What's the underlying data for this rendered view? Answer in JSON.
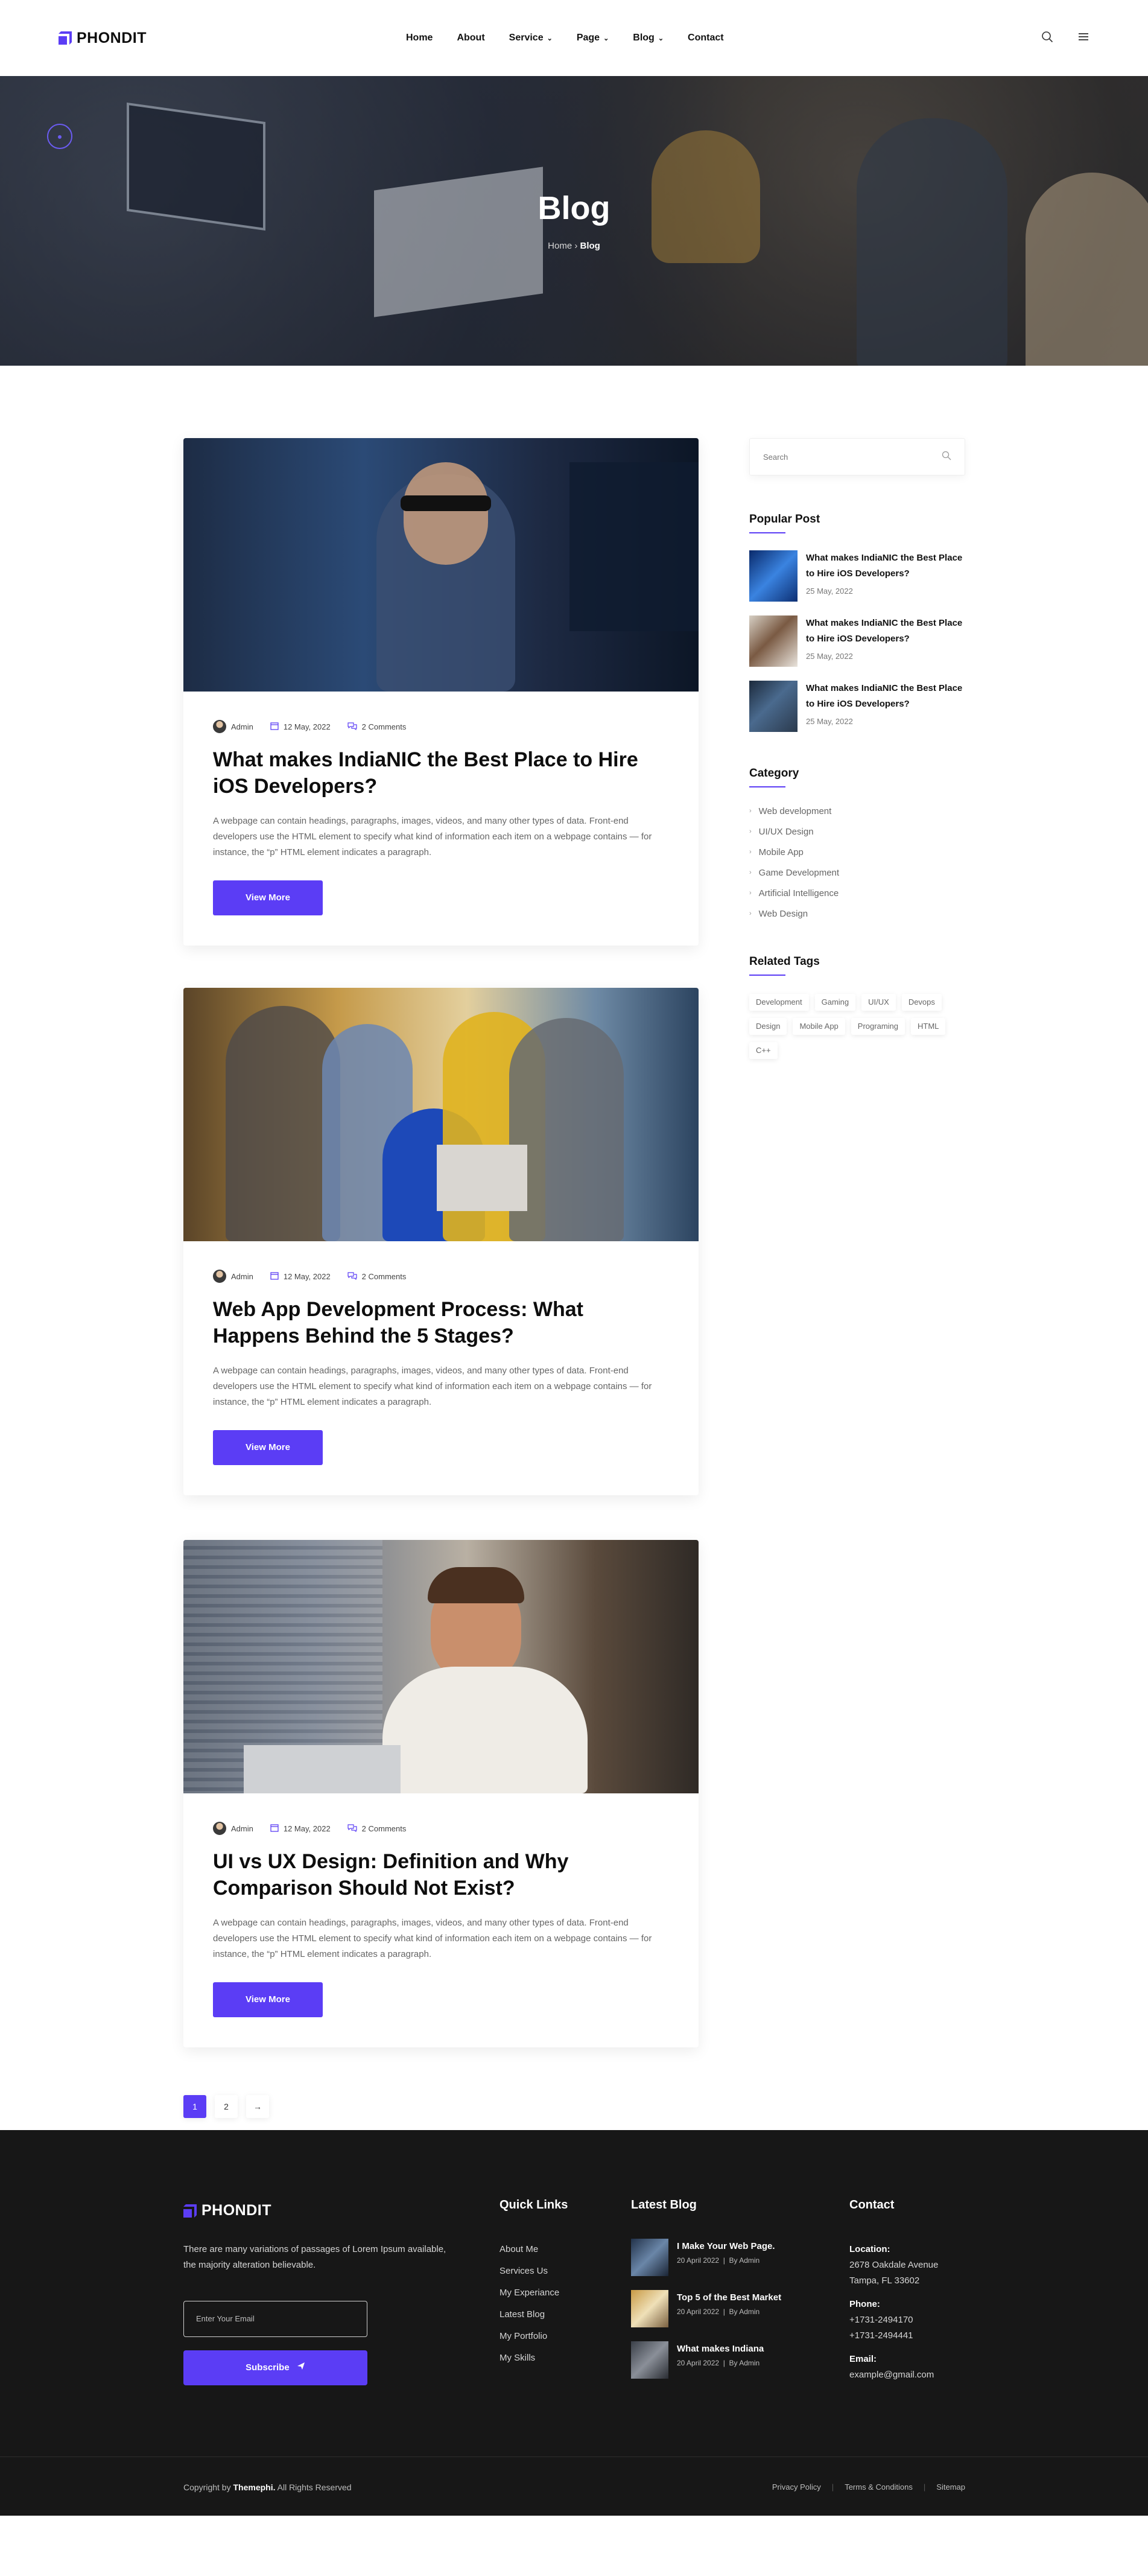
{
  "brand": {
    "name": "PHONDIT",
    "color": "#5b3df5"
  },
  "nav": {
    "items": [
      {
        "label": "Home",
        "dropdown": false
      },
      {
        "label": "About",
        "dropdown": false
      },
      {
        "label": "Service",
        "dropdown": true
      },
      {
        "label": "Page",
        "dropdown": true
      },
      {
        "label": "Blog",
        "dropdown": true
      },
      {
        "label": "Contact",
        "dropdown": false
      }
    ],
    "icons": [
      "search-icon",
      "menu-icon"
    ]
  },
  "hero": {
    "title": "Blog",
    "breadcrumb": {
      "home": "Home",
      "separator": "›",
      "current": "Blog"
    }
  },
  "posts": [
    {
      "author": "Admin",
      "date": "12 May, 2022",
      "comments": "2 Comments",
      "title": "What makes IndiaNIC the Best Place to Hire iOS Developers?",
      "excerpt": "A webpage can contain headings, paragraphs, images, videos, and many other types of data. Front-end developers use the HTML element to specify what kind of information each item on a webpage contains — for instance, the “p” HTML element indicates a paragraph.",
      "button": "View More"
    },
    {
      "author": "Admin",
      "date": "12 May, 2022",
      "comments": "2 Comments",
      "title": "Web App Development Process: What Happens Behind the 5 Stages?",
      "excerpt": "A webpage can contain headings, paragraphs, images, videos, and many other types of data. Front-end developers use the HTML element to specify what kind of information each item on a webpage contains — for instance, the “p” HTML element indicates a paragraph.",
      "button": "View More"
    },
    {
      "author": "Admin",
      "date": "12 May, 2022",
      "comments": "2 Comments",
      "title": "UI vs UX Design: Definition and Why Comparison Should Not Exist?",
      "excerpt": "A webpage can contain headings, paragraphs, images, videos, and many other types of data. Front-end developers use the HTML element to specify what kind of information each item on a webpage contains — for instance, the “p” HTML element indicates a paragraph.",
      "button": "View More"
    }
  ],
  "pagination": {
    "pages": [
      "1",
      "2"
    ],
    "active": "1",
    "next": "→"
  },
  "sidebar": {
    "search_placeholder": "Search",
    "popular_title": "Popular Post",
    "popular": [
      {
        "title": "What makes IndiaNIC the Best Place to Hire iOS Developers?",
        "date": "25 May, 2022"
      },
      {
        "title": "What makes IndiaNIC the Best Place to Hire iOS Developers?",
        "date": "25 May, 2022"
      },
      {
        "title": "What makes IndiaNIC the Best Place to Hire iOS Developers?",
        "date": "25 May, 2022"
      }
    ],
    "category_title": "Category",
    "categories": [
      "Web development",
      "UI/UX Design",
      "Mobile App",
      "Game Development",
      "Artificial Intelligence",
      "Web Design"
    ],
    "tags_title": "Related Tags",
    "tags": [
      "Development",
      "Gaming",
      "UI/UX",
      "Devops",
      "Design",
      "Mobile App",
      "Programing",
      "HTML",
      "C++"
    ]
  },
  "footer": {
    "description": "There are many variations of passages of Lorem Ipsum available, the majority alteration believable.",
    "email_placeholder": "Enter Your Email",
    "subscribe": "Subscribe",
    "quick_links_title": "Quick Links",
    "quick_links": [
      "About Me",
      "Services Us",
      "My Experiance",
      "Latest Blog",
      "My Portfolio",
      "My Skills"
    ],
    "latest_blog_title": "Latest Blog",
    "latest_blog": [
      {
        "title": "I Make Your Web Page.",
        "date": "20 April 2022",
        "by": "By Admin"
      },
      {
        "title": "Top 5 of the Best Market",
        "date": "20 April 2022",
        "by": "By Admin"
      },
      {
        "title": "What makes Indiana",
        "date": "20 April 2022",
        "by": "By Admin"
      }
    ],
    "contact_title": "Contact",
    "contact": {
      "location_label": "Location:",
      "location_line1": "2678 Oakdale Avenue",
      "location_line2": "Tampa, FL 33602",
      "phone_label": "Phone:",
      "phone1": "+1731-2494170",
      "phone2": "+1731-2494441",
      "email_label": "Email:",
      "email": "example@gmail.com"
    },
    "copyright_prefix": "Copyright by",
    "copyright_brand": "Themephi.",
    "copyright_suffix": "All Rights Reserved",
    "legal": [
      "Privacy Policy",
      "Terms & Conditions",
      "Sitemap"
    ]
  }
}
